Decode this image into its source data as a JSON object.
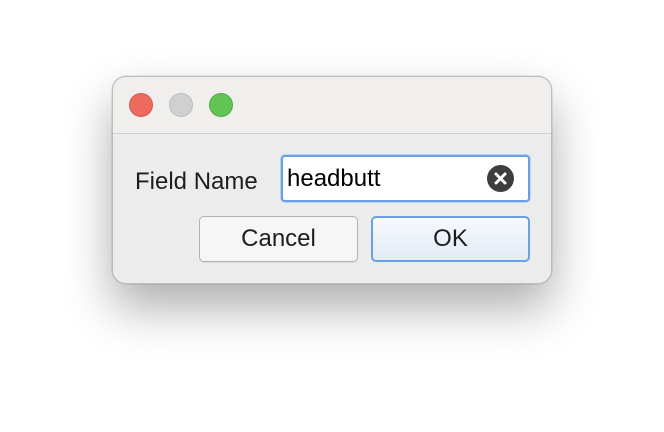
{
  "dialog": {
    "field_label": "Field Name",
    "field_value": "headbutt",
    "cancel_label": "Cancel",
    "ok_label": "OK"
  },
  "titlebar": {
    "icons": [
      "close-button",
      "minimize-button",
      "zoom-button"
    ]
  },
  "colors": {
    "close": "#ee6a5e",
    "minimize": "#d0d0d0",
    "zoom": "#61c454",
    "focus_ring": "#6aa0e2"
  }
}
